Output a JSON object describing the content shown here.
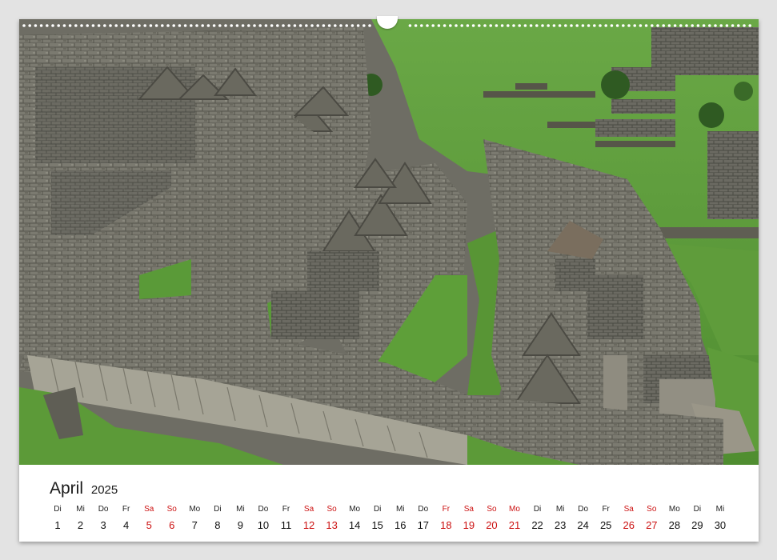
{
  "calendar": {
    "month": "April",
    "year": "2025",
    "days": [
      {
        "dow": "Di",
        "num": "1",
        "red": false
      },
      {
        "dow": "Mi",
        "num": "2",
        "red": false
      },
      {
        "dow": "Do",
        "num": "3",
        "red": false
      },
      {
        "dow": "Fr",
        "num": "4",
        "red": false
      },
      {
        "dow": "Sa",
        "num": "5",
        "red": true
      },
      {
        "dow": "So",
        "num": "6",
        "red": true
      },
      {
        "dow": "Mo",
        "num": "7",
        "red": false
      },
      {
        "dow": "Di",
        "num": "8",
        "red": false
      },
      {
        "dow": "Mi",
        "num": "9",
        "red": false
      },
      {
        "dow": "Do",
        "num": "10",
        "red": false
      },
      {
        "dow": "Fr",
        "num": "11",
        "red": false
      },
      {
        "dow": "Sa",
        "num": "12",
        "red": true
      },
      {
        "dow": "So",
        "num": "13",
        "red": true
      },
      {
        "dow": "Mo",
        "num": "14",
        "red": false
      },
      {
        "dow": "Di",
        "num": "15",
        "red": false
      },
      {
        "dow": "Mi",
        "num": "16",
        "red": false
      },
      {
        "dow": "Do",
        "num": "17",
        "red": false
      },
      {
        "dow": "Fr",
        "num": "18",
        "red": true
      },
      {
        "dow": "Sa",
        "num": "19",
        "red": true
      },
      {
        "dow": "So",
        "num": "20",
        "red": true
      },
      {
        "dow": "Mo",
        "num": "21",
        "red": true
      },
      {
        "dow": "Di",
        "num": "22",
        "red": false
      },
      {
        "dow": "Mi",
        "num": "23",
        "red": false
      },
      {
        "dow": "Do",
        "num": "24",
        "red": false
      },
      {
        "dow": "Fr",
        "num": "25",
        "red": false
      },
      {
        "dow": "Sa",
        "num": "26",
        "red": true
      },
      {
        "dow": "So",
        "num": "27",
        "red": true
      },
      {
        "dow": "Mo",
        "num": "28",
        "red": false
      },
      {
        "dow": "Di",
        "num": "29",
        "red": false
      },
      {
        "dow": "Mi",
        "num": "30",
        "red": false
      }
    ]
  },
  "colors": {
    "holiday_red": "#cc1111",
    "grass": "#5e9a3a",
    "stone": "#77776c"
  }
}
